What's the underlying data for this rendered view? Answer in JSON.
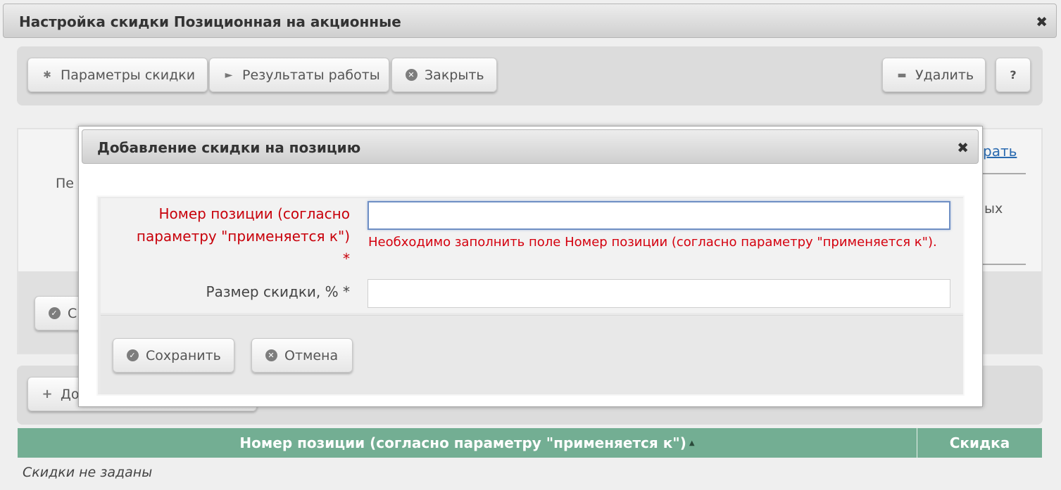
{
  "window": {
    "title": "Настройка скидки Позиционная на акционные",
    "close_glyph": "✖"
  },
  "toolbar": {
    "params_label": "Параметры скидки",
    "results_label": "Результаты работы",
    "close_label": "Закрыть",
    "delete_label": "Удалить",
    "help_label": "?"
  },
  "background_partial": {
    "label_pe": "Пе",
    "text_yh": "ых",
    "link_rat": "рать",
    "btn_s": "С",
    "btn_do": "До"
  },
  "dialog": {
    "title": "Добавление скидки на позицию",
    "close_glyph": "✖",
    "fields": [
      {
        "label_line1": "Номер позиции (согласно",
        "label_line2": "параметру \"применяется к\")",
        "required_mark": "*",
        "value": "",
        "error": "Необходимо заполнить поле Номер позиции (согласно параметру \"применяется к\")."
      },
      {
        "label": "Размер скидки, % *",
        "value": ""
      }
    ],
    "save_label": "Сохранить",
    "cancel_label": "Отмена"
  },
  "grid": {
    "columns": [
      "Номер позиции (согласно параметру \"применяется к\")",
      "Скидка"
    ],
    "sort_indicator": "▲",
    "empty_text": "Скидки не заданы"
  },
  "colors": {
    "grid_header": "#73ae93",
    "error_text": "#c8000a",
    "focus_border": "#6f8fc4"
  }
}
